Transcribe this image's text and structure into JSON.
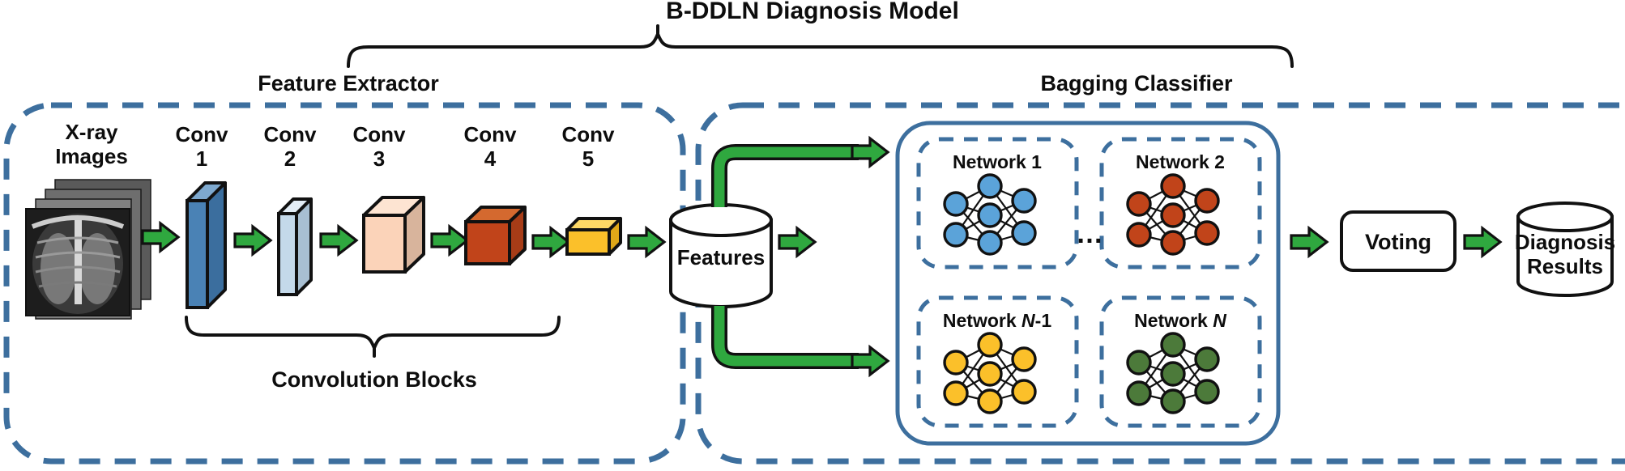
{
  "title": "B-DDLN Diagnosis Model",
  "sections": {
    "feature_extractor": "Feature Extractor",
    "bagging_classifier": "Bagging Classifier",
    "convolution_blocks": "Convolution Blocks"
  },
  "input": {
    "label_line1": "X-ray",
    "label_line2": "Images",
    "icon": "xray-image-stack"
  },
  "conv_layers": [
    {
      "name_line1": "Conv",
      "name_line2": "1",
      "color": "#3b6e9e",
      "shape": "slab"
    },
    {
      "name_line1": "Conv",
      "name_line2": "2",
      "color": "#c4d9ea",
      "shape": "slab"
    },
    {
      "name_line1": "Conv",
      "name_line2": "3",
      "color": "#fbd3b9",
      "shape": "cube"
    },
    {
      "name_line1": "Conv",
      "name_line2": "4",
      "color": "#c1441a",
      "shape": "box"
    },
    {
      "name_line1": "Conv",
      "name_line2": "5",
      "color": "#fbc02a",
      "shape": "flat"
    }
  ],
  "features_store": {
    "label": "Features",
    "shape": "cylinder"
  },
  "networks": [
    {
      "label_prefix": "Network ",
      "label_var": "",
      "label_suffix": "1",
      "color": "#5ba3d9"
    },
    {
      "label_prefix": "Network ",
      "label_var": "",
      "label_suffix": "2",
      "color": "#c1441a"
    },
    {
      "label_prefix": "Network ",
      "label_var": "N",
      "label_suffix": "-1",
      "color": "#fbc02a"
    },
    {
      "label_prefix": "Network ",
      "label_var": "N",
      "label_suffix": "",
      "color": "#4c7a3a"
    }
  ],
  "ellipsis": "…",
  "voting": {
    "label": "Voting"
  },
  "results": {
    "label_line1": "Diagnosis",
    "label_line2": "Results",
    "shape": "cylinder"
  },
  "colors": {
    "dashed_border": "#3d6f9e",
    "solid_border": "#3d6f9e",
    "arrow_green": "#2fa83f",
    "arrow_outline": "#111111",
    "text": "#0d0d0d"
  },
  "icons": {
    "arrow": "green-arrow-icon",
    "brace_top": "curly-brace-up-icon",
    "brace_bottom": "curly-brace-down-icon",
    "network_graph": "neural-network-icon"
  }
}
